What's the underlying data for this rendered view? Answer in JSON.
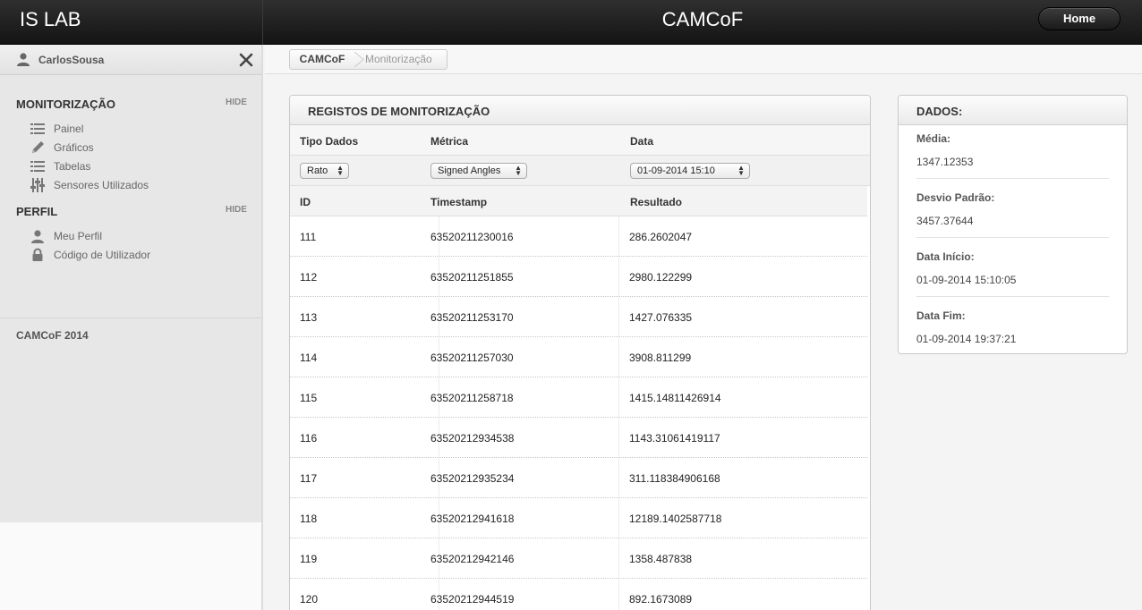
{
  "header": {
    "brand": "IS LAB",
    "title": "CAMCoF",
    "home_label": "Home"
  },
  "sidebar": {
    "user_name": "CarlosSousa",
    "sections": [
      {
        "title": "MONITORIZAÇÃO",
        "hide_label": "HIDE",
        "items": [
          {
            "label": "Painel",
            "icon": "list-icon"
          },
          {
            "label": "Gráficos",
            "icon": "pencil-icon"
          },
          {
            "label": "Tabelas",
            "icon": "list-icon"
          },
          {
            "label": "Sensores Utilizados",
            "icon": "sliders-icon"
          }
        ]
      },
      {
        "title": "PERFIL",
        "hide_label": "HIDE",
        "items": [
          {
            "label": "Meu Perfil",
            "icon": "user-icon"
          },
          {
            "label": "Código de Utilizador",
            "icon": "lock-icon"
          }
        ]
      }
    ],
    "footer": "CAMCoF 2014"
  },
  "breadcrumb": {
    "items": [
      "CAMCoF",
      "Monitorização"
    ]
  },
  "main": {
    "title": "REGISTOS DE MONITORIZAÇÃO",
    "filters": {
      "headers": [
        "Tipo Dados",
        "Métrica",
        "Data"
      ],
      "tipo_dados": "Rato",
      "metrica": "Signed Angles",
      "data": "01-09-2014 15:10"
    },
    "table": {
      "columns": [
        "ID",
        "Timestamp",
        "Resultado"
      ],
      "rows": [
        [
          "111",
          "63520211230016",
          "286.2602047"
        ],
        [
          "112",
          "63520211251855",
          "2980.122299"
        ],
        [
          "113",
          "63520211253170",
          "1427.076335"
        ],
        [
          "114",
          "63520211257030",
          "3908.811299"
        ],
        [
          "115",
          "63520211258718",
          "1415.14811426914"
        ],
        [
          "116",
          "63520212934538",
          "1143.31061419117"
        ],
        [
          "117",
          "63520212935234",
          "311.118384906168"
        ],
        [
          "118",
          "63520212941618",
          "12189.1402587718"
        ],
        [
          "119",
          "63520212942146",
          "1358.487838"
        ],
        [
          "120",
          "63520212944519",
          "892.1673089"
        ]
      ]
    }
  },
  "side": {
    "title": "DADOS:",
    "stats": [
      {
        "label": "Média:",
        "value": "1347.12353"
      },
      {
        "label": "Desvio Padrão:",
        "value": "3457.37644"
      },
      {
        "label": "Data Início:",
        "value": "01-09-2014 15:10:05"
      },
      {
        "label": "Data Fim:",
        "value": "01-09-2014 19:37:21"
      }
    ]
  },
  "colors": {
    "topbar": "#1f1f1f",
    "sidebar": "#e7e7e7",
    "page_bg": "#f4f4f4"
  }
}
